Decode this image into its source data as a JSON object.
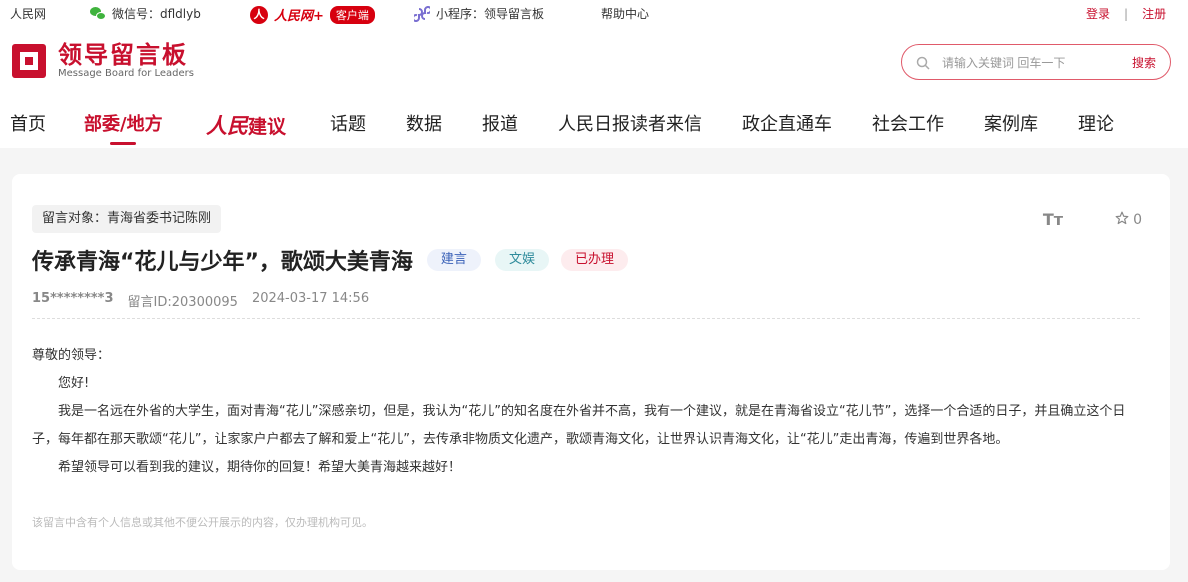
{
  "topbar": {
    "renmin": "人民网",
    "wechat": "微信号：dfldlyb",
    "app_brand": "人民网+",
    "app_badge": "客户端",
    "mini_program": "小程序：领导留言板",
    "help": "帮助中心",
    "login": "登录",
    "separator": "|",
    "register": "注册"
  },
  "header": {
    "logo_cn": "领导留言板",
    "logo_en": "Message Board for Leaders",
    "search_placeholder": "请输入关键词 回车一下",
    "search_button": "搜索"
  },
  "nav": {
    "items": [
      "首页",
      "部委/地方",
      "人民建议",
      "话题",
      "数据",
      "报道",
      "人民日报读者来信",
      "政企直通车",
      "社会工作",
      "案例库",
      "理论"
    ],
    "rm_prefix": "人民",
    "rm_suffix": "建议"
  },
  "post": {
    "target": "留言对象：青海省委书记陈刚",
    "font_tool": "Tт",
    "star_count": "0",
    "title": "传承青海“花儿与少年”，歌颂大美青海",
    "tags": [
      "建言",
      "文娱",
      "已办理"
    ],
    "author": "15********3",
    "message_id": "留言ID:20300095",
    "datetime": "2024-03-17 14:56",
    "salutation": "尊敬的领导：",
    "greeting": "您好!",
    "body": "我是一名远在外省的大学生，面对青海“花儿”深感亲切，但是，我认为“花儿”的知名度在外省并不高，我有一个建议，就是在青海省设立“花儿节”，选择一个合适的日子，并且确立这个日子，每年都在那天歌颂“花儿”，让家家户户都去了解和爱上“花儿”，去传承非物质文化遗产，歌颂青海文化，让世界认识青海文化，让“花儿”走出青海，传遍到世界各地。",
    "closing": "希望领导可以看到我的建议，期待你的回复！希望大美青海越来越好！",
    "privacy_note": "该留言中含有个人信息或其他不便公开展示的内容，仅办理机构可见。"
  },
  "colors": {
    "brand_red": "#c8102e",
    "app_red": "#d7000f",
    "wechat_green": "#3fb33d"
  }
}
